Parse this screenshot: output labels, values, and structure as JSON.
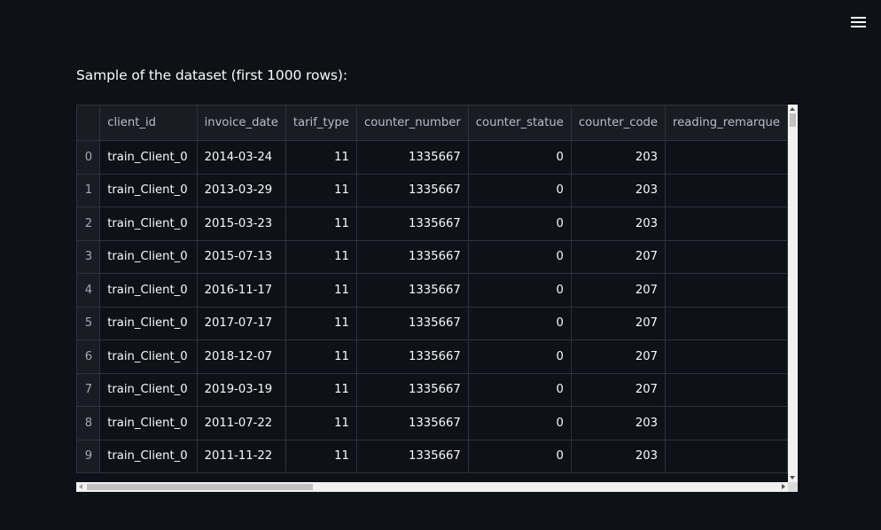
{
  "menu": {
    "icon": "hamburger-menu-icon"
  },
  "caption": "Sample of the dataset (first 1000 rows):",
  "table": {
    "columns": [
      "client_id",
      "invoice_date",
      "tarif_type",
      "counter_number",
      "counter_statue",
      "counter_code",
      "reading_remarque"
    ],
    "rows": [
      {
        "index": "0",
        "cells": [
          "train_Client_0",
          "2014-03-24",
          "11",
          "1335667",
          "0",
          "203",
          ""
        ]
      },
      {
        "index": "1",
        "cells": [
          "train_Client_0",
          "2013-03-29",
          "11",
          "1335667",
          "0",
          "203",
          ""
        ]
      },
      {
        "index": "2",
        "cells": [
          "train_Client_0",
          "2015-03-23",
          "11",
          "1335667",
          "0",
          "203",
          ""
        ]
      },
      {
        "index": "3",
        "cells": [
          "train_Client_0",
          "2015-07-13",
          "11",
          "1335667",
          "0",
          "207",
          ""
        ]
      },
      {
        "index": "4",
        "cells": [
          "train_Client_0",
          "2016-11-17",
          "11",
          "1335667",
          "0",
          "207",
          ""
        ]
      },
      {
        "index": "5",
        "cells": [
          "train_Client_0",
          "2017-07-17",
          "11",
          "1335667",
          "0",
          "207",
          ""
        ]
      },
      {
        "index": "6",
        "cells": [
          "train_Client_0",
          "2018-12-07",
          "11",
          "1335667",
          "0",
          "207",
          ""
        ]
      },
      {
        "index": "7",
        "cells": [
          "train_Client_0",
          "2019-03-19",
          "11",
          "1335667",
          "0",
          "207",
          ""
        ]
      },
      {
        "index": "8",
        "cells": [
          "train_Client_0",
          "2011-07-22",
          "11",
          "1335667",
          "0",
          "203",
          ""
        ]
      },
      {
        "index": "9",
        "cells": [
          "train_Client_0",
          "2011-11-22",
          "11",
          "1335667",
          "0",
          "203",
          ""
        ]
      }
    ]
  },
  "colors": {
    "background": "#0e1117",
    "header_bg": "#1a1c24",
    "grid_line": "#2f323a",
    "text": "#fafafa"
  }
}
